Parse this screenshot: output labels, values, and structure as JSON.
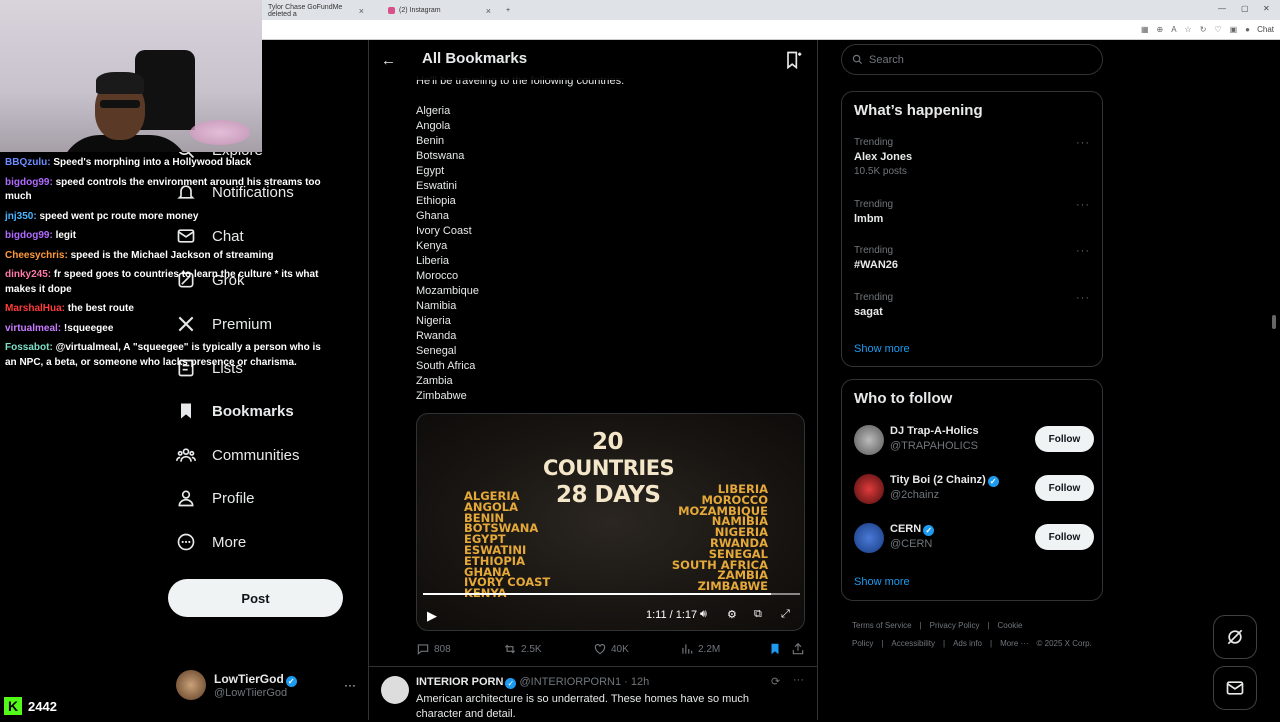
{
  "browser": {
    "tabs": [
      {
        "label": "Tylor Chase GoFundMe deleted a"
      },
      {
        "label": "(2) Instagram"
      }
    ],
    "new_tab_symbol": "+",
    "chat_ext_label": "Chat"
  },
  "stream_chat": [
    {
      "user": "BBQzulu:",
      "color": "#6c8cff",
      "text": "Speed's morphing into a Hollywood black"
    },
    {
      "user": "bigdog99:",
      "color": "#b06bff",
      "text": "speed controls the environment around his streams too much"
    },
    {
      "user": "jnj350:",
      "color": "#49b4ff",
      "text": "speed went pc route more money"
    },
    {
      "user": "bigdog99:",
      "color": "#b06bff",
      "text": "legit"
    },
    {
      "user": "Cheesychris:",
      "color": "#ff9a3c",
      "text": "speed is the Michael Jackson of streaming"
    },
    {
      "user": "dinky245:",
      "color": "#ff7aa8",
      "text": "fr speed goes to countries to learn the culture * its what makes it dope"
    },
    {
      "user": "MarshalHua:",
      "color": "#ff3b3b",
      "text": "the best route"
    },
    {
      "user": "virtualmeal:",
      "color": "#c77dff",
      "text": "!squeegee"
    },
    {
      "user": "Fossabot:",
      "color": "#7de0c8",
      "text": "@virtualmeal, A \"squeegee\" is typically a person who is an NPC, a beta, or someone who lacks presence or charisma."
    }
  ],
  "kick": {
    "logo": "K",
    "viewer_count": "2442"
  },
  "left_nav": {
    "explore": "Explore",
    "notifications": "Notifications",
    "chat": "Chat",
    "grok": "Grok",
    "premium": "Premium",
    "lists": "Lists",
    "bookmarks": "Bookmarks",
    "communities": "Communities",
    "profile": "Profile",
    "more": "More",
    "post_button": "Post"
  },
  "account": {
    "name": "LowTierGod",
    "handle": "@LowTiierGod",
    "more": "···"
  },
  "main": {
    "header_title": "All Bookmarks",
    "intro_text": "He'll be traveling to the following countries:",
    "countries": [
      "Algeria",
      "Angola",
      "Benin",
      "Botswana",
      "Egypt",
      "Eswatini",
      "Ethiopia",
      "Ghana",
      "Ivory Coast",
      "Kenya",
      "Liberia",
      "Morocco",
      "Mozambique",
      "Namibia",
      "Nigeria",
      "Rwanda",
      "Senegal",
      "South Africa",
      "Zambia",
      "Zimbabwe"
    ],
    "video": {
      "title_line1": "20",
      "title_line2": "COUNTRIES",
      "title_line3": "28 DAYS",
      "left_list": [
        "ALGERIA",
        "ANGOLA",
        "BENIN",
        "BOTSWANA",
        "EGYPT",
        "ESWATINI",
        "ETHIOPIA",
        "GHANA",
        "IVORY COAST",
        "KENYA"
      ],
      "right_list": [
        "LIBERIA",
        "MOROCCO",
        "MOZAMBIQUE",
        "NAMIBIA",
        "NIGERIA",
        "RWANDA",
        "SENEGAL",
        "SOUTH AFRICA",
        "ZAMBIA",
        "ZIMBABWE"
      ],
      "time": "1:11 / 1:17",
      "progress": 0.922
    },
    "actions": {
      "replies": "808",
      "reposts": "2.5K",
      "likes": "40K",
      "views": "2.2M"
    },
    "tweet2": {
      "name": "INTERIOR PORN",
      "handle": "@INTERIORPORN1",
      "time": "· 12h",
      "more": "···",
      "text": "American architecture is so underrated. These homes have so much character and detail."
    }
  },
  "sidebar": {
    "search_placeholder": "Search",
    "whats_happening_title": "What’s happening",
    "trends": [
      {
        "context": "Trending",
        "name": "Alex Jones",
        "count": "10.5K posts"
      },
      {
        "context": "Trending",
        "name": "lmbm",
        "count": ""
      },
      {
        "context": "Trending",
        "name": "#WAN26",
        "count": ""
      },
      {
        "context": "Trending",
        "name": "sagat",
        "count": ""
      }
    ],
    "trend_more": "···",
    "show_more": "Show more",
    "who_to_follow_title": "Who to follow",
    "follow_suggestions": [
      {
        "name": "DJ Trap-A-Holics",
        "handle": "@TRAPAHOLICS",
        "verified": false,
        "button": "Follow"
      },
      {
        "name": "Tity Boi (2 Chainz)",
        "handle": "@2chainz",
        "verified": true,
        "button": "Follow"
      },
      {
        "name": "CERN",
        "handle": "@CERN",
        "verified": true,
        "button": "Follow"
      }
    ],
    "show_more_follow": "Show more",
    "footer": [
      "Terms of Service",
      "|",
      "Privacy Policy",
      "|",
      "Cookie Policy",
      "|",
      "Accessibility",
      "|",
      "Ads info",
      "|",
      "More ···",
      "© 2025 X Corp."
    ]
  }
}
